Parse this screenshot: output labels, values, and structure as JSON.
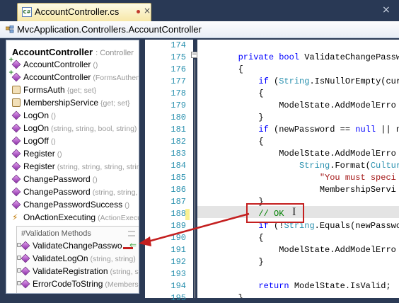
{
  "tab": {
    "label": "AccountController.cs",
    "close": "×"
  },
  "window": {
    "close": "×"
  },
  "breadcrumb": {
    "text": "MvcApplication.Controllers.AccountController"
  },
  "members": {
    "title": "AccountController",
    "subtitle": ": Controller",
    "items": [
      {
        "name": "AccountController",
        "sig": "()",
        "icon": "public-constructor-icon"
      },
      {
        "name": "AccountController",
        "sig": "(FormsAuthenti",
        "icon": "public-constructor-icon"
      },
      {
        "name": "FormsAuth",
        "sig": "{get; set}",
        "icon": "property-icon"
      },
      {
        "name": "MembershipService",
        "sig": "{get; set}",
        "icon": "property-icon"
      },
      {
        "name": "LogOn",
        "sig": "()",
        "icon": "method-icon"
      },
      {
        "name": "LogOn",
        "sig": "(string, string, bool, string)",
        "icon": "method-icon"
      },
      {
        "name": "LogOff",
        "sig": "()",
        "icon": "method-icon"
      },
      {
        "name": "Register",
        "sig": "()",
        "icon": "method-icon"
      },
      {
        "name": "Register",
        "sig": "(string, string, string, string)",
        "icon": "method-icon"
      },
      {
        "name": "ChangePassword",
        "sig": "()",
        "icon": "method-icon"
      },
      {
        "name": "ChangePassword",
        "sig": "(string, string, string)",
        "icon": "method-icon"
      },
      {
        "name": "ChangePasswordSuccess",
        "sig": "()",
        "icon": "method-icon"
      },
      {
        "name": "OnActionExecuting",
        "sig": "(ActionExecuti",
        "icon": "override-method-icon"
      }
    ],
    "region": {
      "title": "#Validation Methods",
      "items": [
        {
          "name": "ValidateChangePasswo",
          "sig": "",
          "icon": "private-method-icon"
        },
        {
          "name": "ValidateLogOn",
          "sig": "(string, string)",
          "icon": "private-method-icon"
        },
        {
          "name": "ValidateRegistration",
          "sig": "(string, stri",
          "icon": "private-method-icon"
        },
        {
          "name": "ErrorCodeToString",
          "sig": "(Membership",
          "icon": "private-method-icon"
        }
      ]
    }
  },
  "editor": {
    "line_numbers": [
      "174",
      "175",
      "176",
      "177",
      "178",
      "179",
      "180",
      "181",
      "182",
      "183",
      "184",
      "185",
      "186",
      "187",
      "188",
      "189",
      "190",
      "191",
      "192",
      "193",
      "194",
      "195"
    ],
    "changed_line": "188",
    "lines": [
      [],
      [
        {
          "t": "        ",
          "c": ""
        },
        {
          "t": "private",
          "c": "kw"
        },
        {
          "t": " ",
          "c": ""
        },
        {
          "t": "bool",
          "c": "kw"
        },
        {
          "t": " ValidateChangePasswo",
          "c": ""
        }
      ],
      [
        {
          "t": "        {",
          "c": ""
        }
      ],
      [
        {
          "t": "            ",
          "c": ""
        },
        {
          "t": "if",
          "c": "kw"
        },
        {
          "t": " (",
          "c": ""
        },
        {
          "t": "String",
          "c": "ty"
        },
        {
          "t": ".IsNullOrEmpty(curr",
          "c": ""
        }
      ],
      [
        {
          "t": "            {",
          "c": ""
        }
      ],
      [
        {
          "t": "                ModelState.AddModelErro",
          "c": ""
        }
      ],
      [
        {
          "t": "            }",
          "c": ""
        }
      ],
      [
        {
          "t": "            ",
          "c": ""
        },
        {
          "t": "if",
          "c": "kw"
        },
        {
          "t": " (newPassword == ",
          "c": ""
        },
        {
          "t": "null",
          "c": "kw"
        },
        {
          "t": " || n",
          "c": ""
        }
      ],
      [
        {
          "t": "            {",
          "c": ""
        }
      ],
      [
        {
          "t": "                ModelState.AddModelErro",
          "c": ""
        }
      ],
      [
        {
          "t": "                    ",
          "c": ""
        },
        {
          "t": "String",
          "c": "ty"
        },
        {
          "t": ".Format(",
          "c": ""
        },
        {
          "t": "Cultur",
          "c": "ty"
        }
      ],
      [
        {
          "t": "                        ",
          "c": ""
        },
        {
          "t": "\"You must speci",
          "c": "str"
        }
      ],
      [
        {
          "t": "                        MembershipServi",
          "c": ""
        }
      ],
      [
        {
          "t": "            }",
          "c": ""
        }
      ],
      [
        {
          "t": "            ",
          "c": ""
        },
        {
          "t": "// OK",
          "c": "cm"
        }
      ],
      [
        {
          "t": "            ",
          "c": ""
        },
        {
          "t": "if",
          "c": "kw"
        },
        {
          "t": " (!",
          "c": ""
        },
        {
          "t": "String",
          "c": "ty"
        },
        {
          "t": ".Equals(newPasswo",
          "c": ""
        }
      ],
      [
        {
          "t": "            {",
          "c": ""
        }
      ],
      [
        {
          "t": "                ModelState.AddModelErro",
          "c": ""
        }
      ],
      [
        {
          "t": "            }",
          "c": ""
        }
      ],
      [],
      [
        {
          "t": "            ",
          "c": ""
        },
        {
          "t": "return",
          "c": "kw"
        },
        {
          "t": " ModelState.IsValid;",
          "c": ""
        }
      ],
      [
        {
          "t": "        }",
          "c": ""
        }
      ]
    ]
  }
}
